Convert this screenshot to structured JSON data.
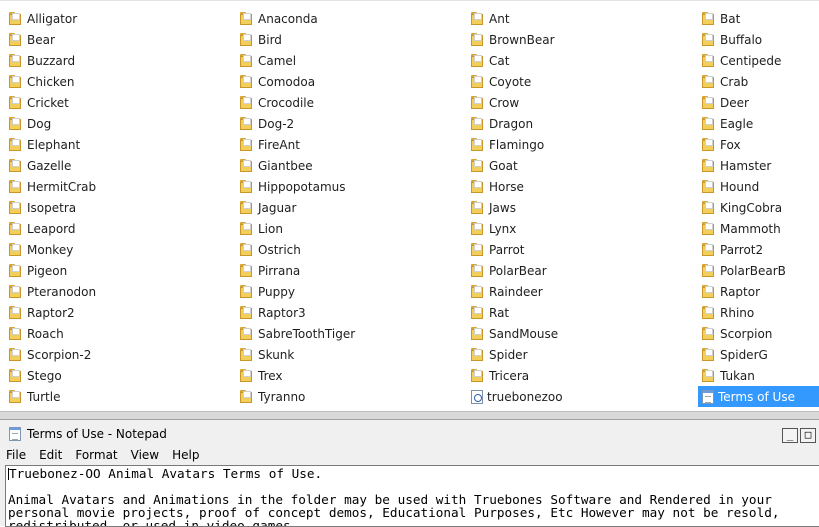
{
  "explorer": {
    "columns": [
      [
        {
          "label": "Alligator",
          "icon": "folder-icon"
        },
        {
          "label": "Bear",
          "icon": "folder-icon"
        },
        {
          "label": "Buzzard",
          "icon": "folder-icon"
        },
        {
          "label": "Chicken",
          "icon": "folder-icon"
        },
        {
          "label": "Cricket",
          "icon": "folder-icon"
        },
        {
          "label": "Dog",
          "icon": "folder-icon"
        },
        {
          "label": "Elephant",
          "icon": "folder-icon"
        },
        {
          "label": "Gazelle",
          "icon": "folder-icon"
        },
        {
          "label": "HermitCrab",
          "icon": "folder-icon"
        },
        {
          "label": "Isopetra",
          "icon": "folder-icon"
        },
        {
          "label": "Leapord",
          "icon": "folder-icon"
        },
        {
          "label": "Monkey",
          "icon": "folder-icon"
        },
        {
          "label": "Pigeon",
          "icon": "folder-icon"
        },
        {
          "label": "Pteranodon",
          "icon": "folder-icon"
        },
        {
          "label": "Raptor2",
          "icon": "folder-icon"
        },
        {
          "label": "Roach",
          "icon": "folder-icon"
        },
        {
          "label": "Scorpion-2",
          "icon": "folder-icon"
        },
        {
          "label": "Stego",
          "icon": "folder-icon"
        },
        {
          "label": "Turtle",
          "icon": "folder-icon"
        }
      ],
      [
        {
          "label": "Anaconda",
          "icon": "folder-icon"
        },
        {
          "label": "Bird",
          "icon": "folder-icon"
        },
        {
          "label": "Camel",
          "icon": "folder-icon"
        },
        {
          "label": "Comodoa",
          "icon": "folder-icon"
        },
        {
          "label": "Crocodile",
          "icon": "folder-icon"
        },
        {
          "label": "Dog-2",
          "icon": "folder-icon"
        },
        {
          "label": "FireAnt",
          "icon": "folder-icon"
        },
        {
          "label": "Giantbee",
          "icon": "folder-icon"
        },
        {
          "label": "Hippopotamus",
          "icon": "folder-icon"
        },
        {
          "label": "Jaguar",
          "icon": "folder-icon"
        },
        {
          "label": "Lion",
          "icon": "folder-icon"
        },
        {
          "label": "Ostrich",
          "icon": "folder-icon"
        },
        {
          "label": "Pirrana",
          "icon": "folder-icon"
        },
        {
          "label": "Puppy",
          "icon": "folder-icon"
        },
        {
          "label": "Raptor3",
          "icon": "folder-icon"
        },
        {
          "label": "SabreToothTiger",
          "icon": "folder-icon"
        },
        {
          "label": "Skunk",
          "icon": "folder-icon"
        },
        {
          "label": "Trex",
          "icon": "folder-icon"
        },
        {
          "label": "Tyranno",
          "icon": "folder-icon"
        }
      ],
      [
        {
          "label": "Ant",
          "icon": "folder-icon"
        },
        {
          "label": "BrownBear",
          "icon": "folder-icon"
        },
        {
          "label": "Cat",
          "icon": "folder-icon"
        },
        {
          "label": "Coyote",
          "icon": "folder-icon"
        },
        {
          "label": "Crow",
          "icon": "folder-icon"
        },
        {
          "label": "Dragon",
          "icon": "folder-icon"
        },
        {
          "label": "Flamingo",
          "icon": "folder-icon"
        },
        {
          "label": "Goat",
          "icon": "folder-icon"
        },
        {
          "label": "Horse",
          "icon": "folder-icon"
        },
        {
          "label": "Jaws",
          "icon": "folder-icon"
        },
        {
          "label": "Lynx",
          "icon": "folder-icon"
        },
        {
          "label": "Parrot",
          "icon": "folder-icon"
        },
        {
          "label": "PolarBear",
          "icon": "folder-icon"
        },
        {
          "label": "Raindeer",
          "icon": "folder-icon"
        },
        {
          "label": "Rat",
          "icon": "folder-icon"
        },
        {
          "label": "SandMouse",
          "icon": "folder-icon"
        },
        {
          "label": "Spider",
          "icon": "folder-icon"
        },
        {
          "label": "Tricera",
          "icon": "folder-icon"
        },
        {
          "label": "truebonezoo",
          "icon": "internet-shortcut-icon"
        }
      ],
      [
        {
          "label": "Bat",
          "icon": "folder-icon"
        },
        {
          "label": "Buffalo",
          "icon": "folder-icon"
        },
        {
          "label": "Centipede",
          "icon": "folder-icon"
        },
        {
          "label": "Crab",
          "icon": "folder-icon"
        },
        {
          "label": "Deer",
          "icon": "folder-icon"
        },
        {
          "label": "Eagle",
          "icon": "folder-icon"
        },
        {
          "label": "Fox",
          "icon": "folder-icon"
        },
        {
          "label": "Hamster",
          "icon": "folder-icon"
        },
        {
          "label": "Hound",
          "icon": "folder-icon"
        },
        {
          "label": "KingCobra",
          "icon": "folder-icon"
        },
        {
          "label": "Mammoth",
          "icon": "folder-icon"
        },
        {
          "label": "Parrot2",
          "icon": "folder-icon"
        },
        {
          "label": "PolarBearB",
          "icon": "folder-icon"
        },
        {
          "label": "Raptor",
          "icon": "folder-icon"
        },
        {
          "label": "Rhino",
          "icon": "folder-icon"
        },
        {
          "label": "Scorpion",
          "icon": "folder-icon"
        },
        {
          "label": "SpiderG",
          "icon": "folder-icon"
        },
        {
          "label": "Tukan",
          "icon": "folder-icon"
        },
        {
          "label": "Terms of Use",
          "icon": "text-file-icon",
          "selected": true
        }
      ]
    ],
    "selection_color": "#3399ff"
  },
  "notepad": {
    "title": "Terms of Use - Notepad",
    "buttons": {
      "minimize": "_",
      "maximize": "□"
    },
    "menu": [
      "File",
      "Edit",
      "Format",
      "View",
      "Help"
    ],
    "lines": [
      "Truebonez-OO Animal Avatars Terms of Use.",
      "",
      "Animal Avatars and Animations in the folder may be used with Truebones Software and Rendered in your",
      "personal movie projects, proof of concept demos, Educational Purposes, Etc However may not be resold,",
      "redistributed, or used in video games"
    ]
  }
}
